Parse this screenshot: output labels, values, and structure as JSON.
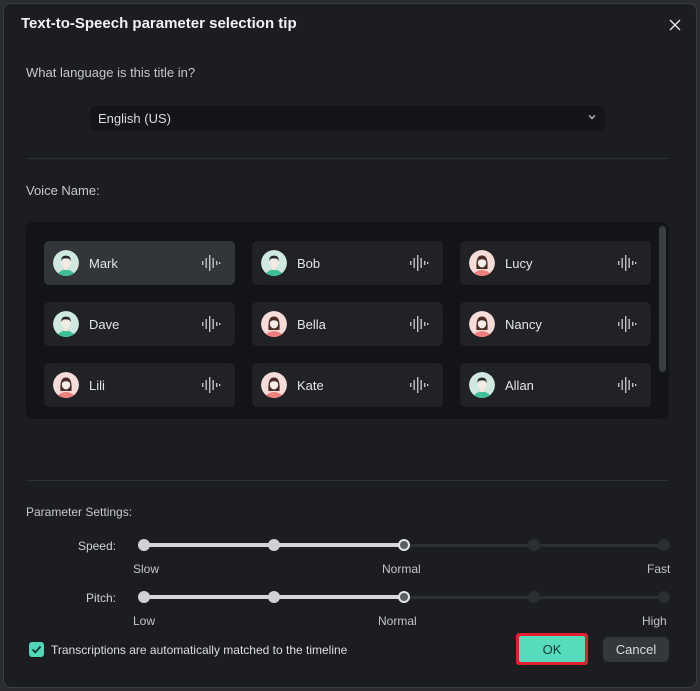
{
  "dialog": {
    "title": "Text-to-Speech parameter selection tip",
    "close_icon": "close-icon"
  },
  "language": {
    "question": "What language is this title in?",
    "selected": "English (US)",
    "dropdown_icon": "chevron-down-icon"
  },
  "voices": {
    "label": "Voice Name:",
    "selected": "Mark",
    "items": [
      {
        "name": "Mark",
        "gender": "male"
      },
      {
        "name": "Bob",
        "gender": "male"
      },
      {
        "name": "Lucy",
        "gender": "female"
      },
      {
        "name": "Dave",
        "gender": "male"
      },
      {
        "name": "Bella",
        "gender": "female"
      },
      {
        "name": "Nancy",
        "gender": "female"
      },
      {
        "name": "Lili",
        "gender": "female"
      },
      {
        "name": "Kate",
        "gender": "female"
      },
      {
        "name": "Allan",
        "gender": "male"
      }
    ],
    "preview_icon": "sound-wave-icon"
  },
  "parameters": {
    "label": "Parameter Settings:",
    "speed": {
      "label": "Speed:",
      "min_label": "Slow",
      "mid_label": "Normal",
      "max_label": "Fast",
      "steps": 5,
      "value_index": 2
    },
    "pitch": {
      "label": "Pitch:",
      "min_label": "Low",
      "mid_label": "Normal",
      "max_label": "High",
      "steps": 5,
      "value_index": 2
    }
  },
  "footer": {
    "checkbox_label": "Transcriptions are automatically matched to the timeline",
    "checkbox_checked": true,
    "ok_label": "OK",
    "cancel_label": "Cancel"
  },
  "colors": {
    "accent": "#56dbbd",
    "highlight_border": "#e0202e",
    "male_avatar": "#3fbf98",
    "female_avatar": "#ef7f7a"
  }
}
